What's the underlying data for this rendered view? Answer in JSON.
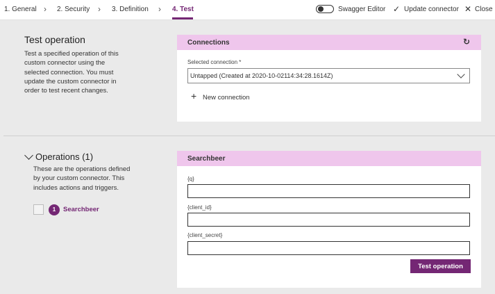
{
  "wizard": {
    "steps": [
      {
        "label": "1. General"
      },
      {
        "label": "2. Security"
      },
      {
        "label": "3. Definition"
      },
      {
        "label": "4. Test"
      }
    ],
    "swagger_label": "Swagger Editor",
    "update_label": "Update connector",
    "close_label": "Close"
  },
  "test_operation": {
    "title": "Test operation",
    "description": "Test a specified operation of this custom connector using the selected connection. You must update the custom connector in order to test recent changes."
  },
  "connections": {
    "header": "Connections",
    "selected_label": "Selected connection *",
    "selected_value": "Untapped (Created at 2020-10-02114:34:28.1614Z)",
    "new_connection_label": "New connection"
  },
  "operations": {
    "title": "Operations (1)",
    "description": "These are the operations defined by your custom connector. This includes actions and triggers.",
    "items": [
      {
        "number": "1",
        "name": "Searchbeer"
      }
    ]
  },
  "operation_form": {
    "header": "Searchbeer",
    "fields": [
      {
        "label": "{q}",
        "value": ""
      },
      {
        "label": "{client_id}",
        "value": ""
      },
      {
        "label": "{client_secret}",
        "value": ""
      }
    ],
    "submit_label": "Test operation"
  },
  "colors": {
    "accent": "#742774",
    "header_bg": "#efc6ec",
    "page_bg": "#eaeaea"
  },
  "icons": {
    "step_separator": "chevron-right-icon",
    "update": "checkmark-icon",
    "close": "close-icon",
    "refresh": "refresh-icon",
    "select": "chevron-down-icon",
    "new_connection": "plus-icon",
    "operations_toggle": "chevron-down-icon"
  }
}
